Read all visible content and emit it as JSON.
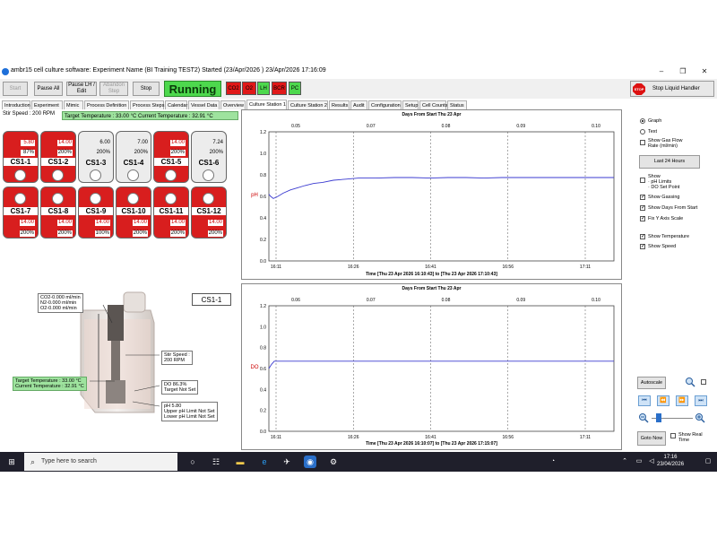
{
  "window": {
    "title": "ambr15 cell culture software: Experiment Name (BI Training TEST2) Started (23/Apr/2026 ) 23/Apr/2026 17:16:09",
    "minimize": "–",
    "maximize": "❐",
    "close": "✕"
  },
  "toolbar": {
    "start": "Start",
    "pause_all": "Pause All",
    "pause_lh": "Pause LH / Edit",
    "abandon_step": "Abandon Step",
    "stop": "Stop",
    "status": "Running",
    "indicators": [
      {
        "label": "CO2",
        "color": "#e01818"
      },
      {
        "label": "O2",
        "color": "#e01818"
      },
      {
        "label": "LH",
        "color": "#4dd84d"
      },
      {
        "label": "BCR",
        "color": "#e01818"
      },
      {
        "label": "PC",
        "color": "#4dd84d"
      }
    ],
    "stop_icon": "STOP",
    "stop_liquid_handler": "Stop Liquid Handler"
  },
  "tabs": [
    "Introduction",
    "Experiment",
    "Mimic",
    "Process Definition",
    "Process Steps",
    "Calendar",
    "Vessel Data",
    "Overview",
    "Culture Station 1",
    "Culture Station 2",
    "Results",
    "Audit",
    "Configuration",
    "Setup",
    "Cell Counts",
    "Status"
  ],
  "active_tab": "Culture Station 1",
  "status": {
    "stir_speed": "Stir Speed : 200 RPM",
    "temperature": "Target Temperature : 33.00 °C  Current Temperature : 32.91 °C"
  },
  "wells": [
    {
      "name": "CS1-1",
      "red": true,
      "v1": "5.80",
      "v1box": true,
      "v1red": true,
      "v2": "87%",
      "v2box": true,
      "v2red": false
    },
    {
      "name": "CS1-2",
      "red": true,
      "v1": "14.00",
      "v1box": true,
      "v1red": true,
      "v2": "200%",
      "v2box": true,
      "v2red": false
    },
    {
      "name": "CS1-3",
      "red": false,
      "v1": "6.00",
      "v1box": false,
      "v1red": false,
      "v2": "200%",
      "v2box": false,
      "v2red": false
    },
    {
      "name": "CS1-4",
      "red": false,
      "v1": "7.00",
      "v1box": false,
      "v1red": false,
      "v2": "200%",
      "v2box": false,
      "v2red": false
    },
    {
      "name": "CS1-5",
      "red": true,
      "v1": "14.00",
      "v1box": true,
      "v1red": true,
      "v2": "200%",
      "v2box": true,
      "v2red": false
    },
    {
      "name": "CS1-6",
      "red": false,
      "v1": "7.24",
      "v1box": false,
      "v1red": false,
      "v2": "200%",
      "v2box": false,
      "v2red": false
    },
    {
      "name": "CS1-7",
      "red": true,
      "v1": "14.00",
      "v1box": true,
      "v1red": true,
      "v2": "200%",
      "v2box": true,
      "v2red": false
    },
    {
      "name": "CS1-8",
      "red": true,
      "v1": "14.00",
      "v1box": true,
      "v1red": true,
      "v2": "200%",
      "v2box": true,
      "v2red": false
    },
    {
      "name": "CS1-9",
      "red": true,
      "v1": "14.00",
      "v1box": true,
      "v1red": true,
      "v2": "100%",
      "v2box": true,
      "v2red": false
    },
    {
      "name": "CS1-10",
      "red": true,
      "v1": "14.00",
      "v1box": true,
      "v1red": true,
      "v2": "200%",
      "v2box": true,
      "v2red": false
    },
    {
      "name": "CS1-11",
      "red": true,
      "v1": "14.00",
      "v1box": true,
      "v1red": true,
      "v2": "200%",
      "v2box": true,
      "v2red": false
    },
    {
      "name": "CS1-12",
      "red": true,
      "v1": "14.00",
      "v1box": true,
      "v1red": true,
      "v2": "200%",
      "v2box": true,
      "v2red": false
    }
  ],
  "vessel": {
    "label": "CS1-1",
    "gas": [
      "CO2-0.000 ml/min",
      "N2-0.000 ml/min",
      "O2-0.000 ml/min"
    ],
    "temp": [
      "Target Temperature : 33.00 °C",
      "Current Temperature : 32.91 °C"
    ],
    "stir": [
      "Stir Speed :",
      "200 RPM"
    ],
    "do": [
      "DO 86.3%",
      "Target Not Set"
    ],
    "ph": [
      "pH 5.80",
      "Upper pH Limit Not Set",
      "Lower pH Limit Not Set"
    ]
  },
  "chart_data": [
    {
      "type": "line",
      "title": "Days From Start Thu 23 Apr",
      "xlabel": "Time [Thu 23 Apr 2026 16:10:43] to [Thu 23 Apr 2026 17:10:43]",
      "ylabel": "pH",
      "top_ticks": [
        "0.05",
        "0.07",
        "0.08",
        "0.09",
        "0.10"
      ],
      "bottom_ticks": [
        "16:11",
        "16:26",
        "16:41",
        "16:56",
        "17:11"
      ],
      "ylim": [
        0,
        1.2
      ],
      "yticks": [
        "1.2",
        "1.0",
        "0.8",
        "0.6",
        "0.4",
        "0.2",
        "0.0"
      ],
      "series": [
        {
          "color": "#3b3bd0",
          "x": [
            0,
            2,
            5,
            10,
            16,
            24,
            32,
            40,
            50,
            60,
            72,
            86,
            100,
            120,
            140,
            160,
            180,
            200,
            220,
            240,
            260,
            280,
            300,
            320,
            340,
            360,
            385
          ],
          "y": [
            0.62,
            0.6,
            0.58,
            0.6,
            0.63,
            0.66,
            0.68,
            0.7,
            0.72,
            0.73,
            0.75,
            0.76,
            0.77,
            0.77,
            0.775,
            0.775,
            0.77,
            0.775,
            0.775,
            0.77,
            0.775,
            0.775,
            0.775,
            0.775,
            0.775,
            0.775,
            0.775
          ]
        }
      ]
    },
    {
      "type": "line",
      "title": "Days From Start Thu 23 Apr",
      "xlabel": "Time [Thu 23 Apr 2026 16:10:07] to [Thu 23 Apr 2026 17:15:07]",
      "ylabel": "DO",
      "top_ticks": [
        "0.06",
        "0.07",
        "0.08",
        "0.09",
        "0.10"
      ],
      "bottom_ticks": [
        "16:11",
        "16:26",
        "16:41",
        "16:56",
        "17:11"
      ],
      "ylim": [
        0,
        1.2
      ],
      "yticks": [
        "1.2",
        "1.0",
        "0.8",
        "0.6",
        "0.4",
        "0.2",
        "0.0"
      ],
      "series": [
        {
          "color": "#3b3bd0",
          "x": [
            0,
            3,
            6,
            10,
            385
          ],
          "y": [
            0.6,
            0.64,
            0.67,
            0.67,
            0.67
          ]
        }
      ]
    }
  ],
  "panel": {
    "graph": "Graph",
    "text": "Text",
    "show_gas_flow": "Show Gas Flow Rate (ml/min)",
    "last_24": "Last 24 Hours",
    "show_limits": [
      "Show",
      "· pH Limits",
      "· DO Set Point"
    ],
    "show_gassing": "Show Gassing",
    "show_days": "Show Days From Start",
    "fix_y": "Fix Y Axis Scale",
    "show_temp": "Show Temperature",
    "show_speed": "Show Speed",
    "autoscale": "Autoscale",
    "goto_now": "Goto Now",
    "show_real_time": "Show Real Time"
  },
  "taskbar": {
    "search_placeholder": "Type here to search",
    "time": "17:16",
    "date": "23/04/2026"
  }
}
